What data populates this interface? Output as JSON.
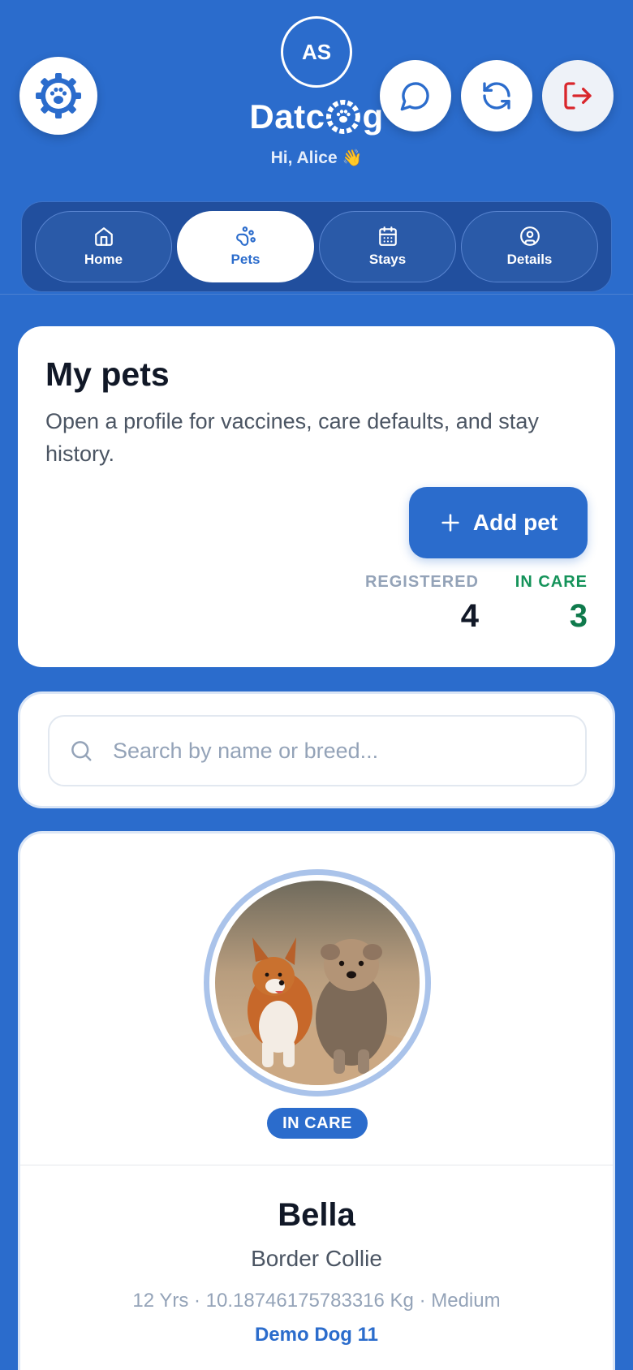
{
  "header": {
    "avatar_initials": "AS",
    "brand_prefix": "Datc",
    "brand_suffix": "g",
    "greeting": "Hi, Alice",
    "greeting_emoji": "👋",
    "icons": {
      "logo": "paw-gear-icon",
      "chat": "chat-bubble-icon",
      "refresh": "refresh-icon",
      "logout": "logout-icon"
    }
  },
  "tabs": [
    {
      "label": "Home",
      "icon": "home-icon",
      "active": false
    },
    {
      "label": "Pets",
      "icon": "paw-icon",
      "active": true
    },
    {
      "label": "Stays",
      "icon": "calendar-icon",
      "active": false
    },
    {
      "label": "Details",
      "icon": "user-circle-icon",
      "active": false
    }
  ],
  "pets_card": {
    "title": "My pets",
    "subtitle": "Open a profile for vaccines, care defaults, and stay history.",
    "add_button": "Add pet",
    "stats": {
      "registered_label": "REGISTERED",
      "registered_value": "4",
      "in_care_label": "IN CARE",
      "in_care_value": "3"
    }
  },
  "search": {
    "placeholder": "Search by name or breed...",
    "value": ""
  },
  "pet": {
    "status_badge": "IN CARE",
    "name": "Bella",
    "breed": "Border Collie",
    "meta": "12 Yrs · 10.18746175783316 Kg · Medium",
    "owner": "Demo Dog 11"
  },
  "colors": {
    "brand_blue": "#2b6ccc",
    "in_care_green": "#0f7a4c",
    "logout_red": "#d9262c"
  }
}
